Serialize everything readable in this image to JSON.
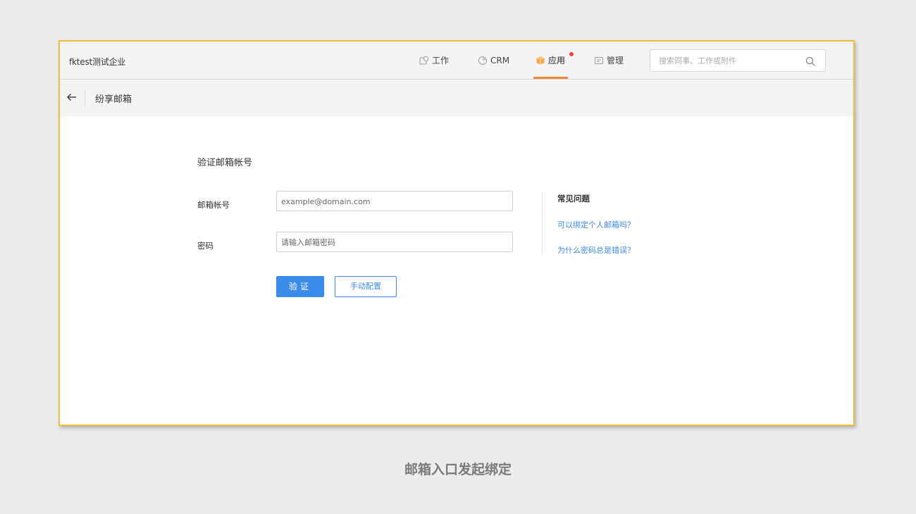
{
  "header": {
    "company": "fktest测试企业",
    "nav": [
      {
        "label": "工作",
        "icon": "work-icon"
      },
      {
        "label": "CRM",
        "icon": "crm-pie-icon"
      },
      {
        "label": "应用",
        "icon": "app-box-icon",
        "active": true,
        "has_notification": true
      },
      {
        "label": "管理",
        "icon": "manage-icon"
      }
    ],
    "search_placeholder": "搜索同事、工作或附件",
    "accent_color": "#f08a3b"
  },
  "subheader": {
    "title": "纷享邮箱"
  },
  "form": {
    "heading": "验证邮箱帐号",
    "email_label": "邮箱帐号",
    "email_placeholder": "example@domain.com",
    "password_label": "密码",
    "password_placeholder": "请输入邮箱密码",
    "verify_button": "验证",
    "manual_button": "手动配置",
    "primary_color": "#3b8beb"
  },
  "faq": {
    "title": "常见问题",
    "links": [
      "可以绑定个人邮箱吗？",
      "为什么密码总是错误？"
    ]
  },
  "caption": "邮箱入口发起绑定"
}
